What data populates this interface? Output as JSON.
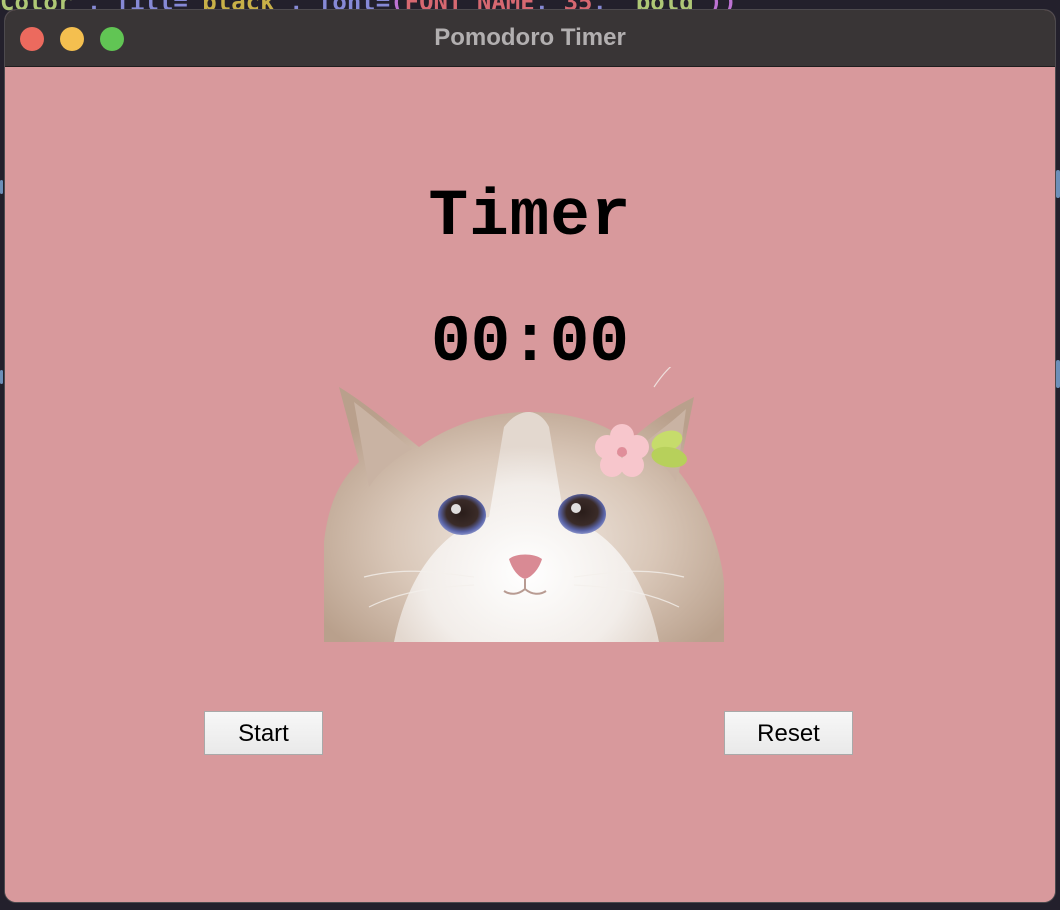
{
  "window": {
    "title": "Pomodoro Timer"
  },
  "header": {
    "label": "Timer",
    "time": "00:00"
  },
  "image": {
    "description_icon": "cat-photo"
  },
  "buttons": {
    "start_label": "Start",
    "reset_label": "Reset"
  },
  "colors": {
    "background": "#d8999c",
    "titlebar": "#393536",
    "close": "#ec6a5e",
    "minimize": "#f4bf4f",
    "maximize": "#61c554"
  }
}
